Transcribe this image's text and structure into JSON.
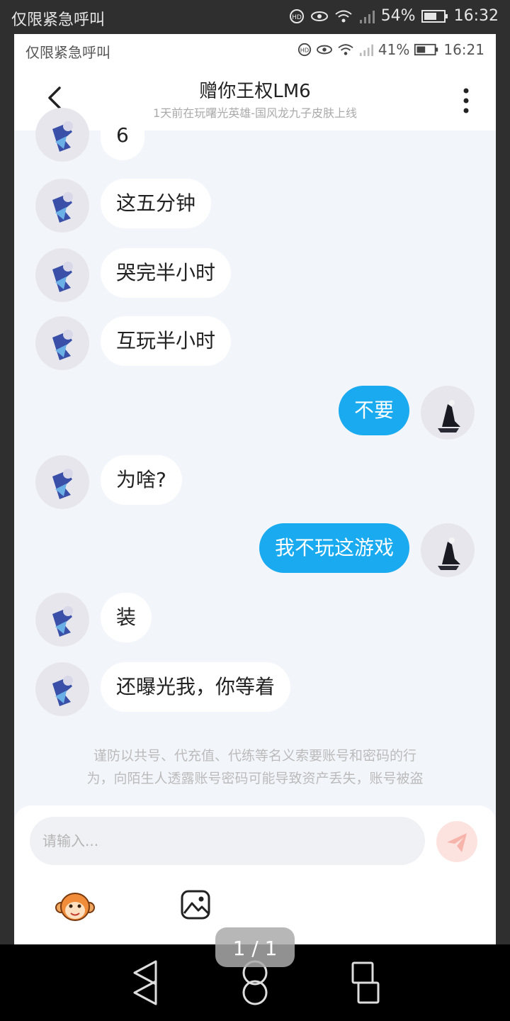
{
  "outer_status": {
    "carrier": "仅限紧急呼叫",
    "battery": "54%",
    "time": "16:32"
  },
  "inner_status": {
    "carrier": "仅限紧急呼叫",
    "battery": "41%",
    "time": "16:21"
  },
  "header": {
    "title": "赠你王权LM6",
    "subtitle": "1天前在玩曙光英雄-国风龙九子皮肤上线"
  },
  "messages": [
    {
      "side": "left",
      "text": "6"
    },
    {
      "side": "left",
      "text": "这五分钟"
    },
    {
      "side": "left",
      "text": "哭完半小时"
    },
    {
      "side": "left",
      "text": "互玩半小时"
    },
    {
      "side": "right",
      "text": "不要"
    },
    {
      "side": "left",
      "text": "为啥?"
    },
    {
      "side": "right",
      "text": "我不玩这游戏"
    },
    {
      "side": "left",
      "text": "装"
    },
    {
      "side": "left",
      "text": "还曝光我，你等着"
    }
  ],
  "warning": {
    "line1": "谨防以共号、代充值、代练等名义索要账号和密码的行",
    "line2": "为，向陌生人透露账号密码可能导致资产丢失，账号被盗"
  },
  "composer": {
    "placeholder": "请输入..."
  },
  "pager": {
    "text": "1 / 1"
  },
  "icons": {
    "back": "chevron-left-icon",
    "more": "more-vertical-icon",
    "send": "paper-plane-icon",
    "emoji": "monkey-emoji-icon",
    "image": "image-icon",
    "nav_back": "triangle-back-icon",
    "nav_home": "circle-home-icon",
    "nav_recent": "square-recent-icon"
  },
  "colors": {
    "accent": "#1aaaf0",
    "send_bg": "#fde3e0",
    "send_icon": "#f7b4ab",
    "chat_bg": "#f2f5fa"
  }
}
